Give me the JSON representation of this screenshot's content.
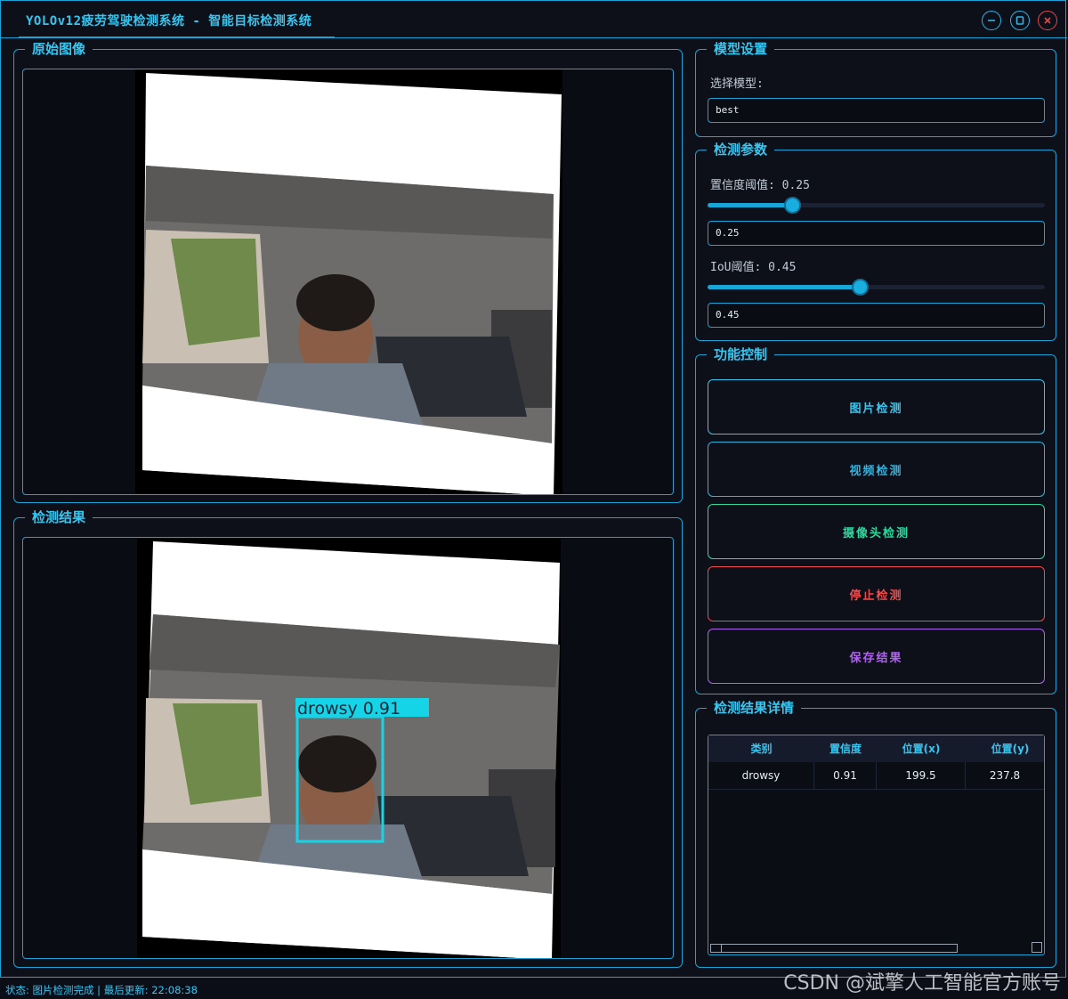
{
  "window": {
    "title": "YOLOv12疲劳驾驶检测系统 - 智能目标检测系统"
  },
  "panels": {
    "original": {
      "title": "原始图像"
    },
    "result": {
      "title": "检测结果",
      "detection_label": "drowsy 0.91"
    }
  },
  "model_settings": {
    "title": "模型设置",
    "select_label": "选择模型:",
    "model_value": "best"
  },
  "params": {
    "title": "检测参数",
    "confidence_label": "置信度阈值: 0.25",
    "confidence_value": "0.25",
    "confidence_level": 0.25,
    "iou_label": "IoU阈值: 0.45",
    "iou_value": "0.45",
    "iou_level": 0.45
  },
  "controls": {
    "title": "功能控制",
    "image_detect": "图片检测",
    "video_detect": "视频检测",
    "camera_detect": "摄像头检测",
    "stop_detect": "停止检测",
    "save_result": "保存结果"
  },
  "details": {
    "title": "检测结果详情",
    "columns": [
      "类别",
      "置信度",
      "位置(x)",
      "位置(y)"
    ],
    "rows": [
      [
        "drowsy",
        "0.91",
        "199.5",
        "237.8"
      ]
    ]
  },
  "status": {
    "text": "状态: 图片检测完成 | 最后更新: 22:08:38"
  },
  "watermark": "CSDN @斌擎人工智能官方账号",
  "colors": {
    "accent": "#1aa3d6",
    "image_btn": "#37c6f0",
    "video_btn": "#2fb4e0",
    "camera_btn": "#2ed9a0",
    "stop_btn": "#f04a4a",
    "save_btn": "#b062f0"
  }
}
